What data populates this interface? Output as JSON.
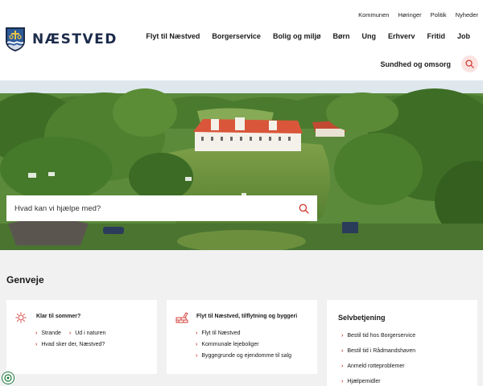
{
  "brand": {
    "name": "NÆSTVED"
  },
  "utility_nav": [
    "Kommunen",
    "Høringer",
    "Politik",
    "Nyheder"
  ],
  "main_nav": [
    "Flyt til Næstved",
    "Borgerservice",
    "Bolig og miljø",
    "Børn",
    "Ung",
    "Erhverv",
    "Fritid",
    "Job"
  ],
  "nav_row2": {
    "label": "Sundhed og omsorg"
  },
  "hero_search": {
    "placeholder": "Hvad kan vi hjælpe med?"
  },
  "section": {
    "title": "Genveje"
  },
  "cards": [
    {
      "title": "Klar til sommer?",
      "links": [
        "Strande",
        "Ud i naturen",
        "Hvad sker der, Næstved?"
      ]
    },
    {
      "title": "Flyt til Næstved, tilflytning og byggeri",
      "links": [
        "Flyt til Næstved",
        "Kommunale lejeboliger",
        "Byggegrunde og ejendomme til salg"
      ]
    },
    {
      "title": "Selvbetjening",
      "links": [
        "Bestil tid hos Borgerservice",
        "Bestil tid i Rådmandshaven",
        "Anmeld rotteproblemer",
        "Hjælpemidler"
      ]
    }
  ],
  "colors": {
    "accent": "#d3413a",
    "accent_light": "#fbe3e1",
    "brand": "#1c2b4a",
    "background": "#f1f1f1"
  },
  "icons": [
    "shield-logo-icon",
    "search-icon",
    "sun-icon",
    "brick-wall-icon",
    "chevron-right-icon",
    "cookie-settings-icon"
  ]
}
